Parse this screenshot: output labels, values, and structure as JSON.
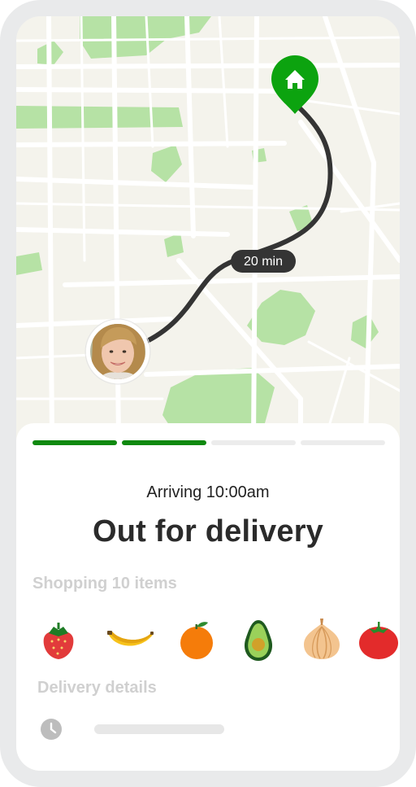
{
  "map": {
    "eta_label": "20 min",
    "destination_icon": "home-icon",
    "courier_avatar": "avatar",
    "route_color": "#343434",
    "park_color": "#b6e2a5",
    "road_color": "#ffffff",
    "pin_color": "#0ca30f"
  },
  "delivery": {
    "arriving_text": "Arriving 10:00am",
    "status_title": "Out for delivery",
    "progress": {
      "completed_steps": 2,
      "total_steps": 4
    }
  },
  "shopping": {
    "label": "Shopping 10 items",
    "items": [
      "strawberry-icon",
      "banana-icon",
      "orange-icon",
      "avocado-icon",
      "onion-icon",
      "tomato-icon"
    ]
  },
  "details": {
    "label": "Delivery details",
    "icon": "clock-icon"
  },
  "colors": {
    "accent": "#108910",
    "progress_inactive": "#ececec",
    "muted_text": "#d0d0d0"
  }
}
